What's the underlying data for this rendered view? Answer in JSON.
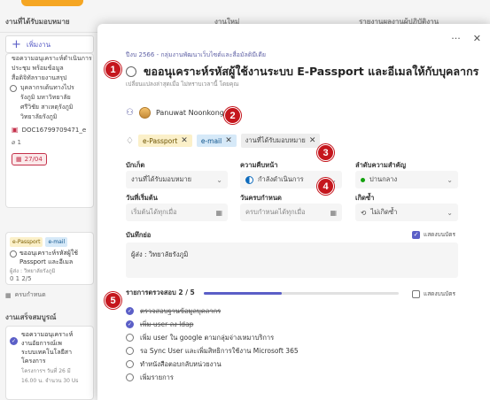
{
  "board": {
    "column1_title": "งานที่ได้รับมอบหมาย",
    "column2_title": "งานใหม่",
    "column3_title": "รายงานผลงานผู้ปฏิบัติงาน",
    "add_task_label": "เพิ่มงาน",
    "card1": {
      "lines": [
        "ขอความอนุเคราะห์ดำเนินการ",
        "ประชุม พร้อมข้อมูล",
        "สื่อดิจิทัลรายงานสรุป"
      ],
      "radio_lines": [
        "บุคลากรเด้นทางไปร",
        "รังภูมิ มหาวิทยาลัย",
        "ศรีวิชัย สาเหตุรังภูมิ",
        "วิทยาลัยรังภูมิ"
      ],
      "file_name": "DOC16799709471_e",
      "attach_count": "1",
      "due_date": "27/04"
    },
    "card2": {
      "tags": [
        "e-Passport",
        "e-mail"
      ],
      "lines": [
        "ขออนุเคราะห์รหัสผู้ใช้",
        "Passport และอีเมล"
      ],
      "sub": "ผู้ส่ง : วิทยาลัยรังภูมิ",
      "stats": "0   1   2/5"
    },
    "due_row_label": "ครบกำหนด",
    "group2_title": "งานเสร็จสมบูรณ์",
    "card3": {
      "lines": [
        "ขอความอนุเคราะห์",
        "งานอัยการณ์เพ",
        "ระบบเทคโนโลยีสา",
        "โครงการ"
      ],
      "sub": [
        "โครงการฯ วันที่ 26 มี",
        "16.00 น. จำนวน 30 Us"
      ]
    }
  },
  "modal": {
    "more_icon_label": "···",
    "close_icon_label": "✕",
    "breadcrumb": "ปีงบ 2566 - กลุ่มงานพัฒนาเว็บไซต์และสื่อมัลติมีเดีย",
    "task_title": "ขออนุเคราะห์รหัสผู้ใช้งานระบบ E-Passport และอีเมลให้กับบุคลากร",
    "change_note": "เปลี่ยนแปลงล่าสุดเมื่อ ไม่ทราบเวลานี้ โดยคุณ",
    "assignee": "Panuwat Noonkong",
    "labels": [
      {
        "text": "e-Passport",
        "color": "yellow"
      },
      {
        "text": "e-mail",
        "color": "blue"
      },
      {
        "text": "งานที่ได้รับมอบหมาย",
        "color": "gray"
      }
    ],
    "fields": {
      "bucket_label": "บักเก็ต",
      "bucket_value": "งานที่ได้รับมอบหมาย",
      "progress_label": "ความคืบหน้า",
      "progress_value": "กำลังดำเนินการ",
      "priority_label": "ลำดับความสำคัญ",
      "priority_value": "ปานกลาง",
      "start_label": "วันที่เริ่มต้น",
      "start_placeholder": "เริ่มต้นได้ทุกเมื่อ",
      "due_label": "วันครบกำหนด",
      "due_placeholder": "ครบกำหนดได้ทุกเมื่อ",
      "repeat_label": "เกิดซ้ำ",
      "repeat_value": "ไม่เกิดซ้ำ"
    },
    "notes_label": "บันทึกย่อ",
    "show_on_card_label": "แสดงบนบัตร",
    "notes_text": "ผู้ส่ง : วิทยาลัยรังภูมิ",
    "checklist_title": "รายการตรวจสอบ 2 / 5",
    "checklist_progress": 0.4,
    "checklist_show_label": "แสดงบนบัตร",
    "checklist": [
      {
        "text": "ตรวจสอบฐานข้อมูลบุคลากร",
        "done": true
      },
      {
        "text": "เพิ่ม user ลง ldap",
        "done": true
      },
      {
        "text": "เพิ่ม user ใน google ตามกลุ่มจ่างเหมาบริการ",
        "done": false
      },
      {
        "text": "รอ Sync User และเพิ่มสิทธิการใช้งาน Microsoft 365",
        "done": false
      },
      {
        "text": "ทำหนังสือตอบกลับหน่วยงาน",
        "done": false
      },
      {
        "text": "เพิ่มรายการ",
        "done": false
      }
    ]
  },
  "badges": [
    "1",
    "2",
    "3",
    "4",
    "5"
  ],
  "colors": {
    "accent": "#5b5fc7",
    "badge": "#c5161d",
    "due_red": "#c4314b",
    "progress_blue": "#0f6cbd",
    "priority_green": "#13a10e"
  }
}
